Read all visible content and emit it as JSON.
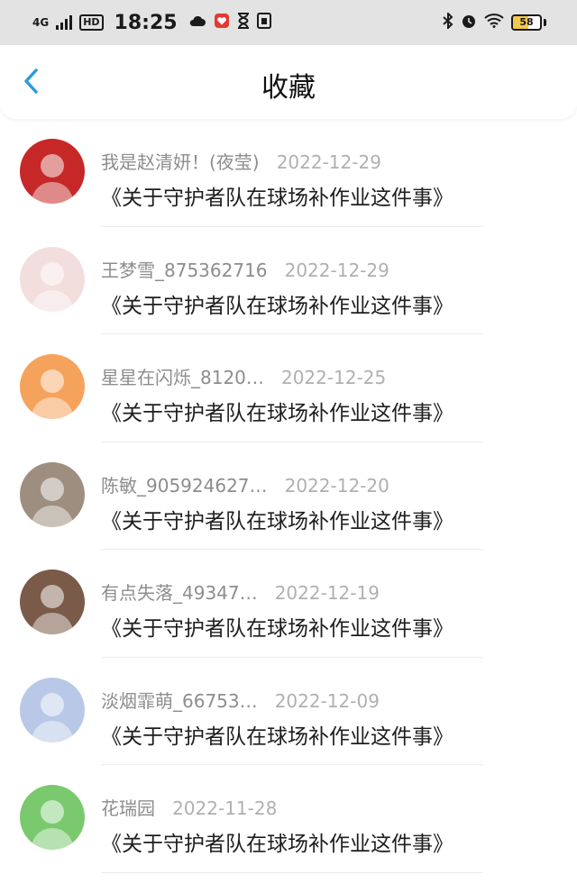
{
  "status": {
    "network": "4G",
    "hd": "HD",
    "time": "18:25",
    "battery": "58",
    "battery_level": 0.58,
    "icons_left": [
      "cloud-icon",
      "app-badge-icon",
      "hourglass-icon",
      "sim-icon"
    ],
    "icons_right": [
      "bluetooth-icon",
      "alarm-icon",
      "wifi-icon",
      "battery-icon"
    ]
  },
  "navbar": {
    "title": "收藏",
    "back_icon": "chevron-left-icon",
    "accent": "#2d9cdb"
  },
  "favorites": [
    {
      "author": "我是赵清妍！(夜莹)",
      "date": "2022-12-29",
      "title": "《关于守护者队在球场补作业这件事》",
      "avatar_color": "#c62828"
    },
    {
      "author": "王梦雪_875362716",
      "date": "2022-12-29",
      "title": "《关于守护者队在球场补作业这件事》",
      "avatar_color": "#f3dede"
    },
    {
      "author": "星星在闪烁_8120…",
      "date": "2022-12-25",
      "title": "《关于守护者队在球场补作业这件事》",
      "avatar_color": "#f5a35c"
    },
    {
      "author": "陈敏_905924627…",
      "date": "2022-12-20",
      "title": "《关于守护者队在球场补作业这件事》",
      "avatar_color": "#9e8e80"
    },
    {
      "author": "有点失落_49347…",
      "date": "2022-12-19",
      "title": "《关于守护者队在球场补作业这件事》",
      "avatar_color": "#7a5a48"
    },
    {
      "author": "淡烟霏萌_66753…",
      "date": "2022-12-09",
      "title": "《关于守护者队在球场补作业这件事》",
      "avatar_color": "#b8c8e6"
    },
    {
      "author": "花瑞园",
      "date": "2022-11-28",
      "title": "《关于守护者队在球场补作业这件事》",
      "avatar_color": "#7bc96f"
    }
  ]
}
